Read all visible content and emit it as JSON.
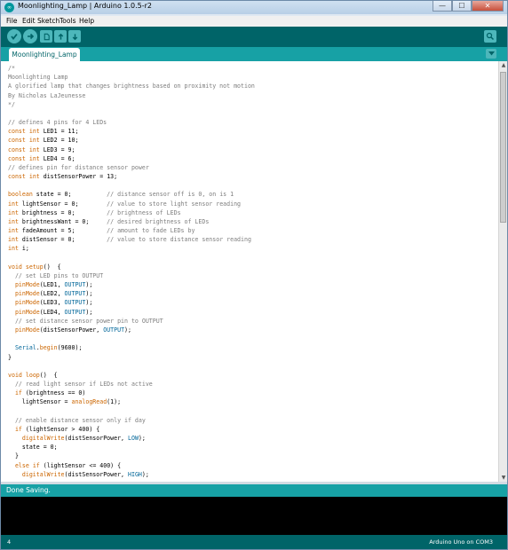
{
  "window": {
    "title": "Moonlighting_Lamp | Arduino 1.0.5-r2",
    "icon_label": "∞",
    "minimize_label": "—",
    "maximize_label": "☐",
    "close_label": "✕"
  },
  "menu": {
    "items": [
      "File",
      "Edit",
      "Sketch",
      "Tools",
      "Help"
    ]
  },
  "toolbar": {
    "buttons": [
      {
        "name": "verify",
        "icon": "check-icon"
      },
      {
        "name": "upload",
        "icon": "arrow-right-icon"
      },
      {
        "name": "new",
        "icon": "new-file-icon"
      },
      {
        "name": "open",
        "icon": "arrow-up-icon"
      },
      {
        "name": "save",
        "icon": "arrow-down-icon"
      }
    ],
    "serial_monitor_icon": "magnifier-icon"
  },
  "tabs": {
    "active": "Moonlighting_Lamp",
    "menu_icon": "triangle-down-icon"
  },
  "editor": {
    "lines": [
      "/*",
      "Moonlighting Lamp",
      "A glorified lamp that changes brightness based on proximity not motion",
      "By Nicholas LaJeunesse",
      "*/",
      "",
      "// defines 4 pins for 4 LEDs",
      "const int LED1 = 11;",
      "const int LED2 = 10;",
      "const int LED3 = 9;",
      "const int LED4 = 6;",
      "// defines pin for distance sensor power",
      "const int distSensorPower = 13;",
      "",
      "boolean state = 0;          // distance sensor off is 0, on is 1",
      "int lightSensor = 0;        // value to store light sensor reading",
      "int brightness = 0;         // brightness of LEDs",
      "int brightnessWant = 0;     // desired brightness of LEDs",
      "int fadeAmount = 5;         // amount to fade LEDs by",
      "int distSensor = 0;         // value to store distance sensor reading",
      "int i;",
      "",
      "void setup()  {",
      "  // set LED pins to OUTPUT",
      "  pinMode(LED1, OUTPUT);",
      "  pinMode(LED2, OUTPUT);",
      "  pinMode(LED3, OUTPUT);",
      "  pinMode(LED4, OUTPUT);",
      "  // set distance sensor power pin to OUTPUT",
      "  pinMode(distSensorPower, OUTPUT);",
      "",
      "  Serial.begin(9600);",
      "}",
      "",
      "void loop()  {",
      "  // read light sensor if LEDs not active",
      "  if (brightness == 0)",
      "    lightSensor = analogRead(1);",
      "",
      "  // enable distance sensor only if day",
      "  if (lightSensor > 400) {",
      "    digitalWrite(distSensorPower, LOW);",
      "    state = 0;",
      "  }",
      "  else if (lightSensor <= 400) {",
      "    digitalWrite(distSensorPower, HIGH);"
    ]
  },
  "status": {
    "message": "Done Saving."
  },
  "bottom": {
    "line_number": "4",
    "board": "Arduino Uno on COM3"
  },
  "colors": {
    "toolbar": "#006468",
    "tabbar": "#17a1a5",
    "button": "#4db7bb",
    "comment": "#7e7e7e",
    "keyword": "#cc6600",
    "type": "#006699"
  }
}
